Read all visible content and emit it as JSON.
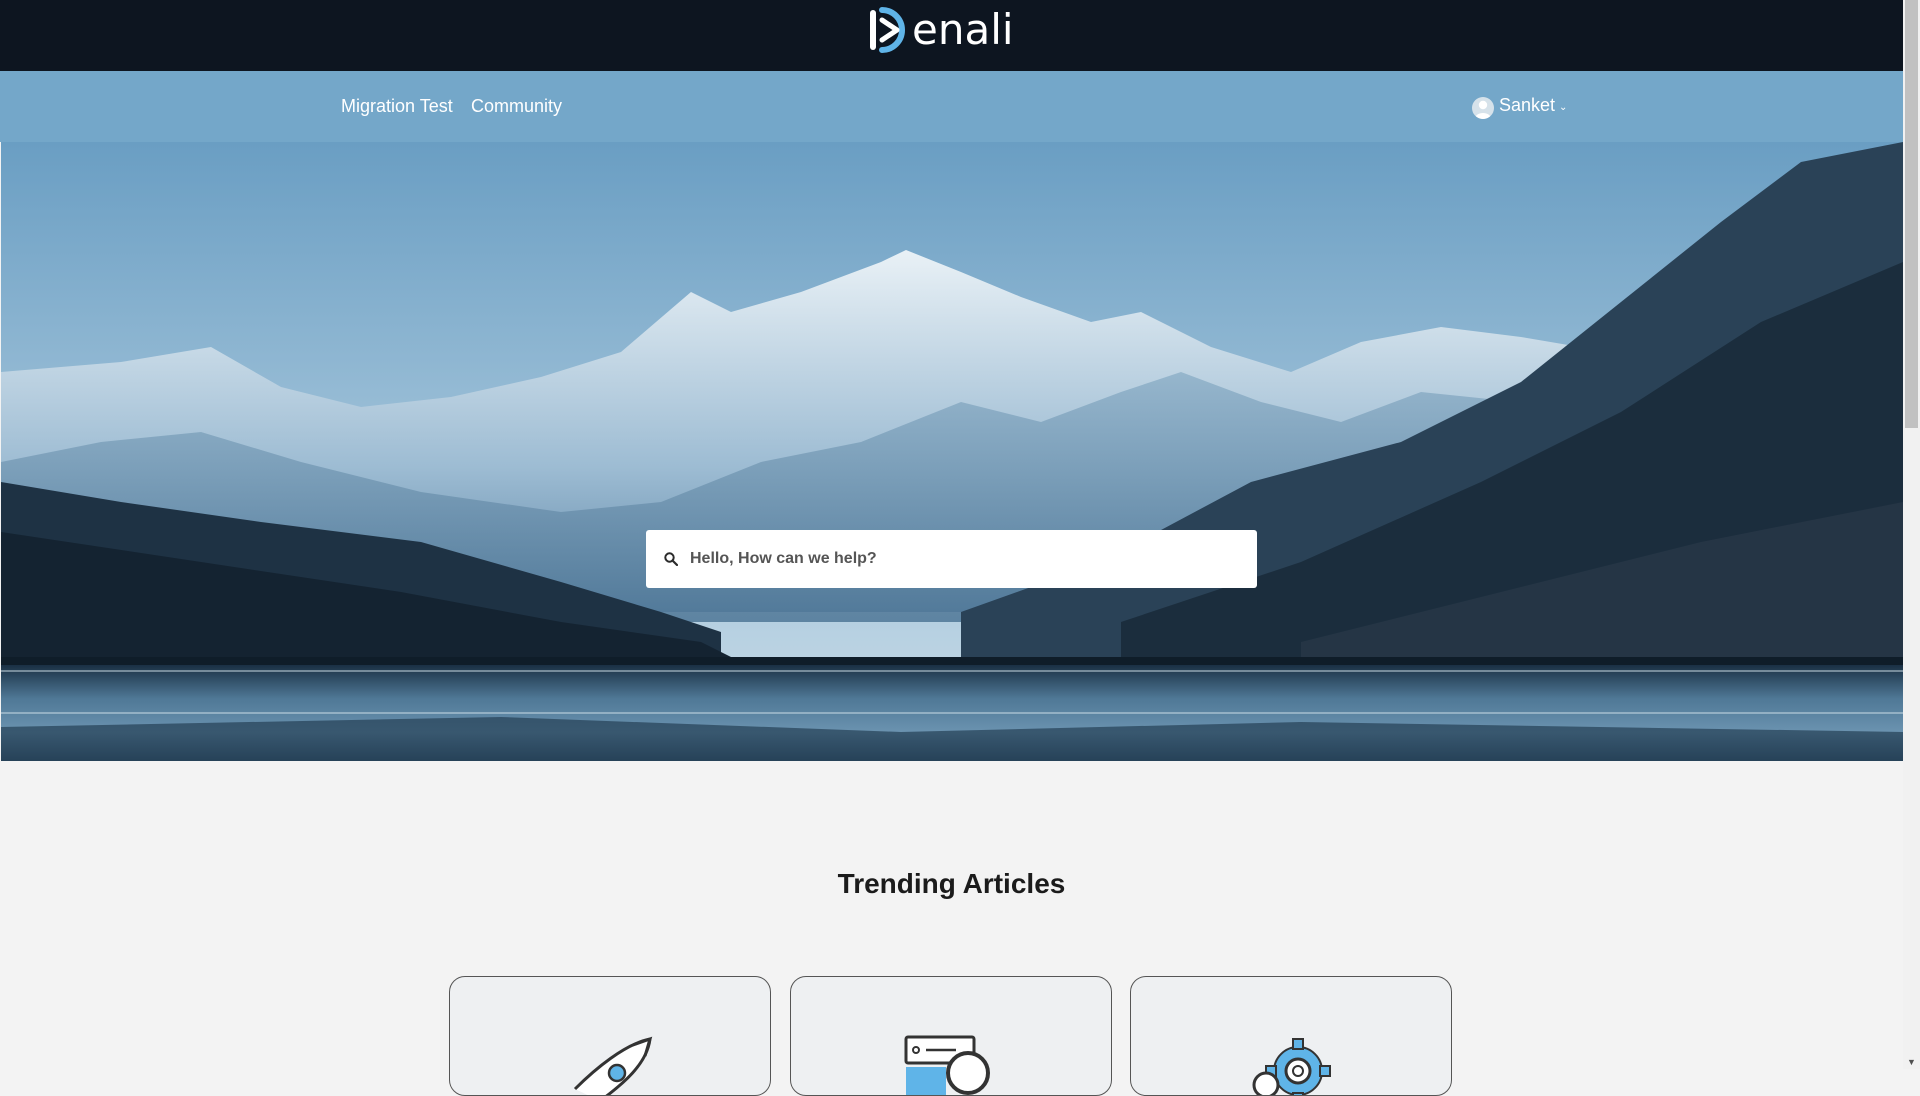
{
  "brand": {
    "name": "enali",
    "colors": {
      "topbar": "#0d1520",
      "navbar": "#74a7c9",
      "accent": "#5fb4e8"
    }
  },
  "nav": {
    "links": [
      "Migration Test",
      "Community"
    ],
    "user": {
      "name": "Sanket",
      "icon": "user-avatar-icon",
      "chevron": "⌄"
    }
  },
  "hero": {
    "search": {
      "placeholder": "Hello, How can we help?",
      "icon": "search-icon"
    }
  },
  "trending": {
    "title": "Trending Articles",
    "cards": [
      {
        "icon": "rocket-icon"
      },
      {
        "icon": "server-search-icon"
      },
      {
        "icon": "gear-icon"
      }
    ]
  }
}
